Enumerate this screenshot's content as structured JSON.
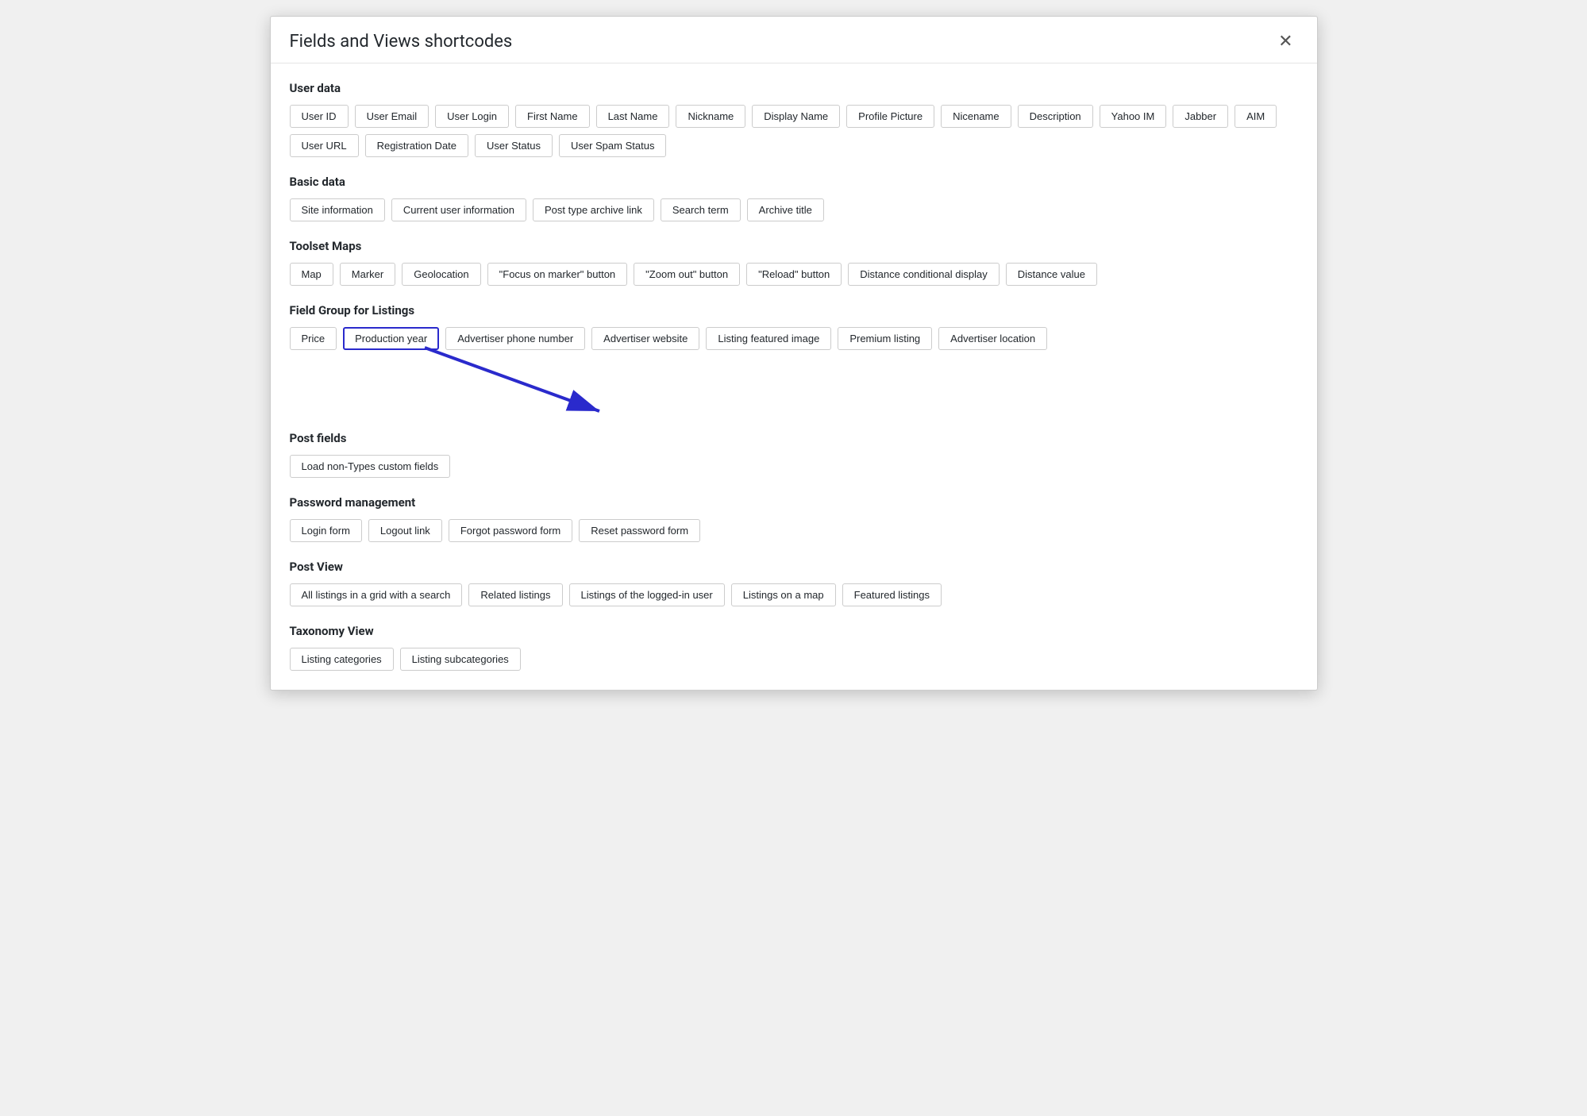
{
  "modal": {
    "title": "Fields and Views shortcodes",
    "close_label": "✕"
  },
  "sections": [
    {
      "id": "user-data",
      "title": "User data",
      "items": [
        "User ID",
        "User Email",
        "User Login",
        "First Name",
        "Last Name",
        "Nickname",
        "Display Name",
        "Profile Picture",
        "Nicename",
        "Description",
        "Yahoo IM",
        "Jabber",
        "AIM",
        "User URL",
        "Registration Date",
        "User Status",
        "User Spam Status"
      ]
    },
    {
      "id": "basic-data",
      "title": "Basic data",
      "items": [
        "Site information",
        "Current user information",
        "Post type archive link",
        "Search term",
        "Archive title"
      ]
    },
    {
      "id": "toolset-maps",
      "title": "Toolset Maps",
      "items": [
        "Map",
        "Marker",
        "Geolocation",
        "\"Focus on marker\" button",
        "\"Zoom out\" button",
        "\"Reload\" button",
        "Distance conditional display",
        "Distance value"
      ]
    },
    {
      "id": "field-group-listings",
      "title": "Field Group for Listings",
      "items": [
        "Price",
        "Production year",
        "Advertiser phone number",
        "Advertiser website",
        "Listing featured image",
        "Premium listing",
        "Advertiser location"
      ],
      "highlighted": "Production year"
    },
    {
      "id": "post-fields",
      "title": "Post fields",
      "items": [
        "Load non-Types custom fields"
      ]
    },
    {
      "id": "password-management",
      "title": "Password management",
      "items": [
        "Login form",
        "Logout link",
        "Forgot password form",
        "Reset password form"
      ]
    },
    {
      "id": "post-view",
      "title": "Post View",
      "items": [
        "All listings in a grid with a search",
        "Related listings",
        "Listings of the logged-in user",
        "Listings on a map",
        "Featured listings"
      ]
    },
    {
      "id": "taxonomy-view",
      "title": "Taxonomy View",
      "items": [
        "Listing categories",
        "Listing subcategories"
      ]
    }
  ]
}
